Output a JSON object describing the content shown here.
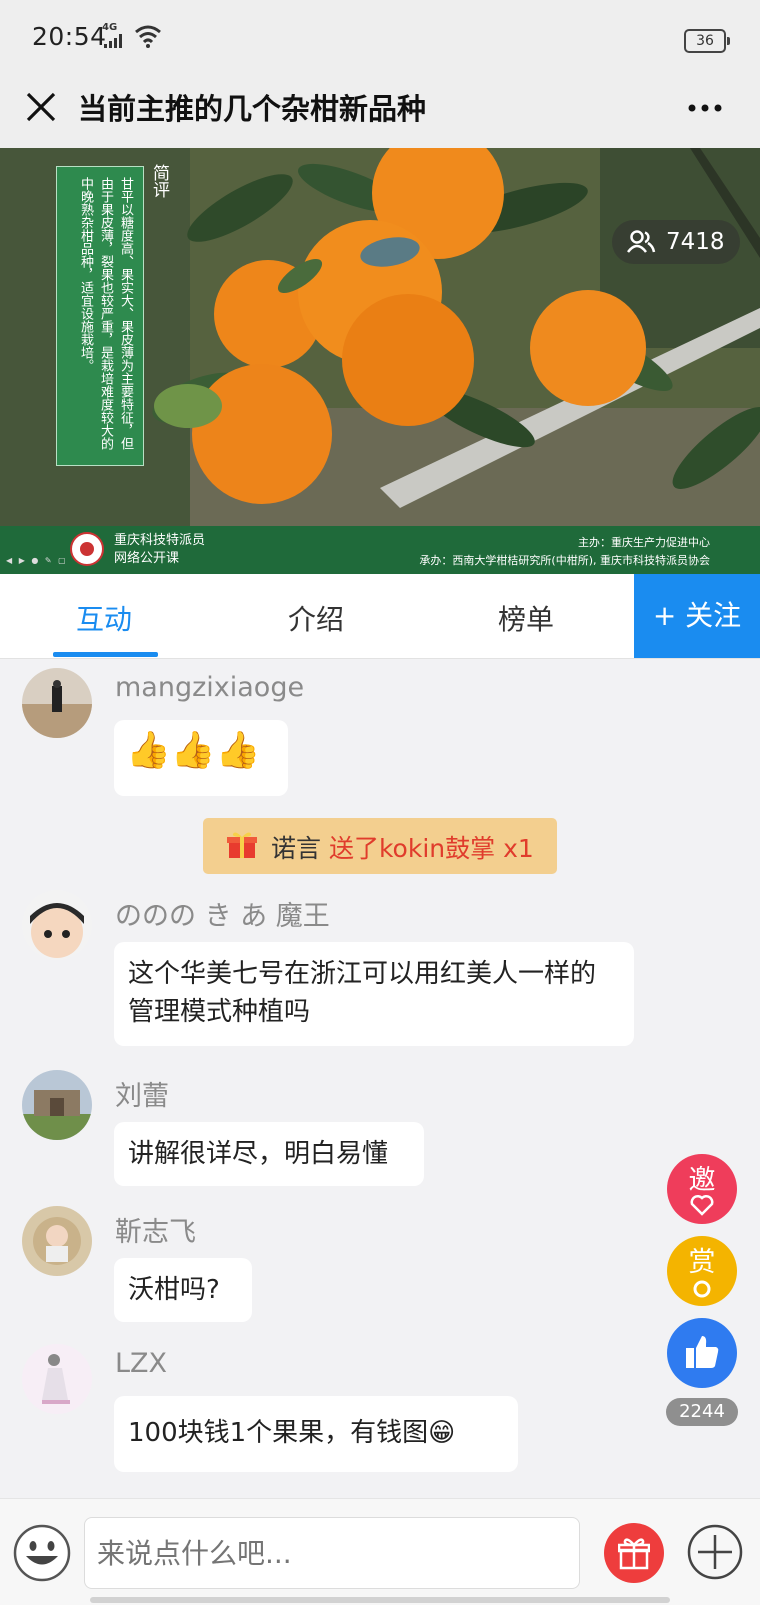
{
  "status_bar": {
    "time": "20:54",
    "network": "4G",
    "battery": "36"
  },
  "title_bar": {
    "title": "当前主推的几个杂柑新品种"
  },
  "video": {
    "intro_heading": "简评",
    "intro_text": "甘平以糖度高、果实大、果皮薄为主要特征，但由于果皮薄，裂果也较严重，是栽培难度较大的中晚熟杂柑品种，适宜设施栽培。",
    "viewer_count": "7418",
    "footer_org": [
      "重庆科技特派员",
      "网络公开课"
    ],
    "footer_host": "主办：重庆生产力促进中心",
    "footer_sponsor": "承办：西南大学柑桔研究所(中柑所), 重庆市科技特派员协会"
  },
  "tabs": {
    "interact": "互动",
    "intro": "介绍",
    "rank": "榜单",
    "follow": "+ 关注"
  },
  "gift": {
    "sender": "诺言",
    "action": "送了kokin鼓掌 x1"
  },
  "messages": [
    {
      "user": "mangzixiaoge",
      "text": "👍👍👍"
    },
    {
      "user": "ののの き あ 魔王",
      "text": "这个华美七号在浙江可以用红美人一样的管理模式种植吗"
    },
    {
      "user": "刘蕾",
      "text": "讲解很详尽，明白易懂"
    },
    {
      "user": "靳志飞",
      "text": "沃柑吗?"
    },
    {
      "user": "LZX",
      "text": "100块钱1个果果，有钱图😁"
    }
  ],
  "float_buttons": {
    "invite": "邀",
    "reward": "赏",
    "like_count": "2244"
  },
  "input": {
    "placeholder": "来说点什么吧..."
  },
  "colors": {
    "accent": "#1a8cf0",
    "gift_banner": "#f3cf8f",
    "invite": "#ef3d5b",
    "reward": "#f4b400",
    "like": "#2f7bf0"
  }
}
